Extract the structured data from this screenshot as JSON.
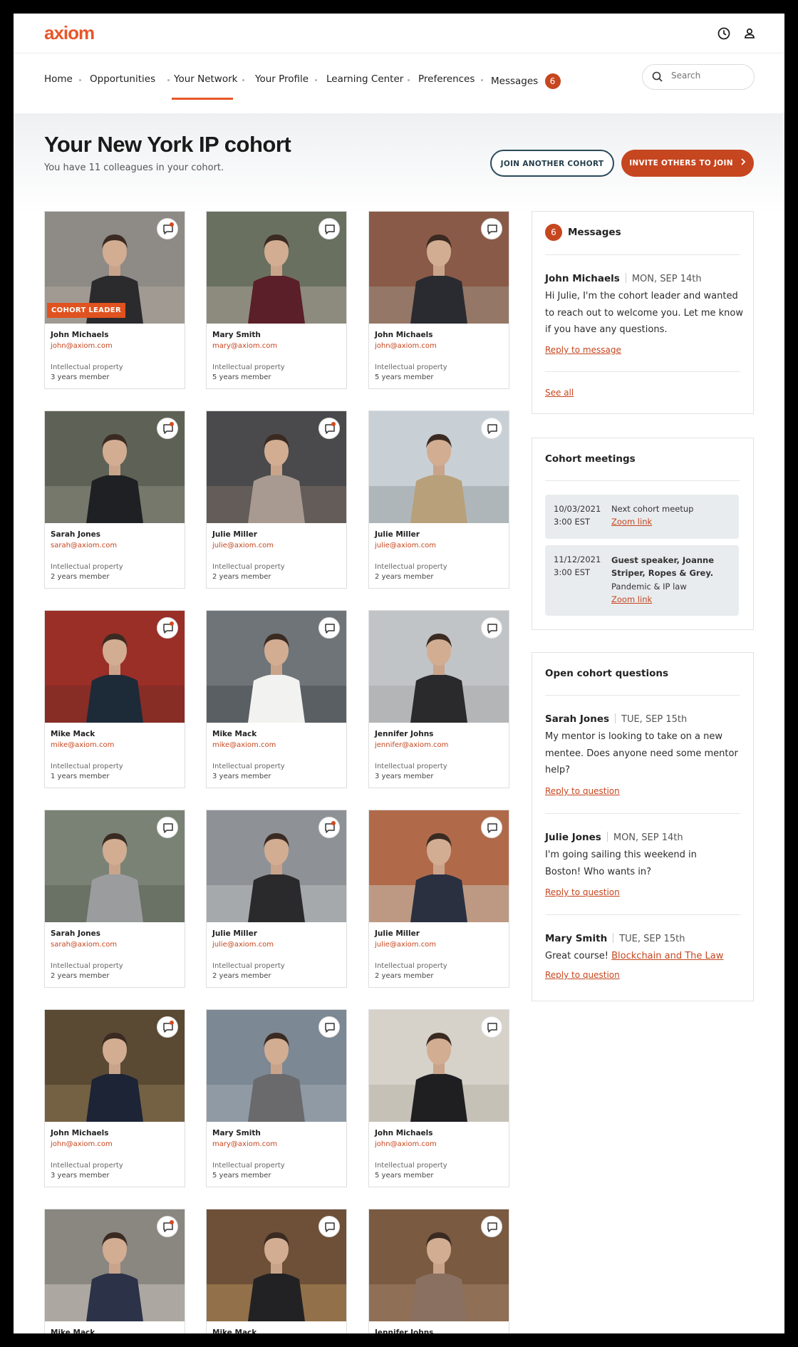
{
  "brand": {
    "logo": "axiom",
    "accent": "#e8572a",
    "dark_accent": "#c6461f",
    "outline": "#2b4a5a"
  },
  "nav": {
    "items": [
      {
        "label": "Home"
      },
      {
        "label": "Opportunities"
      },
      {
        "label": "Your Network",
        "active": true
      },
      {
        "label": "Your Profile"
      },
      {
        "label": "Learning Center"
      },
      {
        "label": "Preferences"
      },
      {
        "label": "Messages",
        "badge": "6"
      }
    ]
  },
  "search": {
    "placeholder": "Search"
  },
  "header": {
    "title": "Your New York IP cohort",
    "subtitle": "You have 11 colleagues in your cohort.",
    "join_button": "JOIN ANOTHER COHORT",
    "invite_button": "INVITE OTHERS TO JOIN"
  },
  "cohort": {
    "leader_tag": "COHORT LEADER",
    "members": [
      {
        "name": "John Michaels",
        "email": "john@axiom.com",
        "field": "Intellectual property",
        "years": "3 years member"
      },
      {
        "name": "Mary Smith",
        "email": "mary@axiom.com",
        "field": "Intellectual property",
        "years": "5 years member"
      },
      {
        "name": "John Michaels",
        "email": "john@axiom.com",
        "field": "Intellectual property",
        "years": "5 years member"
      },
      {
        "name": "Sarah Jones",
        "email": "sarah@axiom.com",
        "field": "Intellectual property",
        "years": "2 years member"
      },
      {
        "name": "Julie Miller",
        "email": "julie@axiom.com",
        "field": "Intellectual property",
        "years": "2 years member"
      },
      {
        "name": "Julie Miller",
        "email": "julie@axiom.com",
        "field": "Intellectual property",
        "years": "2 years member"
      },
      {
        "name": "Mike Mack",
        "email": "mike@axiom.com",
        "field": "Intellectual property",
        "years": "1 years member"
      },
      {
        "name": "Mike Mack",
        "email": "mike@axiom.com",
        "field": "Intellectual property",
        "years": "3 years member"
      },
      {
        "name": "Jennifer Johns",
        "email": "jennifer@axiom.com",
        "field": "Intellectual property",
        "years": "3 years member"
      },
      {
        "name": "Sarah Jones",
        "email": "sarah@axiom.com",
        "field": "Intellectual property",
        "years": "2 years member"
      },
      {
        "name": "Julie Miller",
        "email": "julie@axiom.com",
        "field": "Intellectual property",
        "years": "2 years member"
      },
      {
        "name": "Julie Miller",
        "email": "julie@axiom.com",
        "field": "Intellectual property",
        "years": "2 years member"
      },
      {
        "name": "John Michaels",
        "email": "john@axiom.com",
        "field": "Intellectual property",
        "years": "3 years member"
      },
      {
        "name": "Mary Smith",
        "email": "mary@axiom.com",
        "field": "Intellectual property",
        "years": "5 years member"
      },
      {
        "name": "John Michaels",
        "email": "john@axiom.com",
        "field": "Intellectual property",
        "years": "5 years member"
      },
      {
        "name": "Mike Mack"
      },
      {
        "name": "Mike Mack"
      },
      {
        "name": "Jennifer Johns"
      }
    ]
  },
  "messages": {
    "badge": "6",
    "title": "Messages",
    "author": "John Michaels",
    "date": "MON, SEP 14th",
    "text": "Hi Julie, I'm the cohort leader and wanted to reach out to welcome you. Let me know if you have any questions.",
    "reply": "Reply to message",
    "see_all": "See all"
  },
  "meetings": {
    "title": "Cohort meetings",
    "items": [
      {
        "date": "10/03/2021",
        "time": "3:00 EST",
        "title": "Next cohort meetup",
        "link": "Zoom link"
      },
      {
        "date": "11/12/2021",
        "time": "3:00 EST",
        "title": "Guest speaker, Joanne Striper, Ropes & Grey.",
        "sub": "Pandemic & IP law",
        "link": "Zoom link"
      }
    ]
  },
  "questions": {
    "title": "Open cohort questions",
    "items": [
      {
        "author": "Sarah Jones",
        "date": "TUE, SEP 15th",
        "text": "My mentor is looking to take on a new mentee.  Does anyone need some mentor help?",
        "reply": "Reply to question"
      },
      {
        "author": "Julie Jones",
        "date": "MON, SEP 14th",
        "text": "I'm going sailing this weekend in Boston! Who wants in?",
        "reply": "Reply to question"
      },
      {
        "author": "Mary Smith",
        "date": "TUE, SEP 15th",
        "text": "Great course!",
        "link_text": "Blockchain and The Law",
        "reply": "Reply to question"
      }
    ]
  }
}
